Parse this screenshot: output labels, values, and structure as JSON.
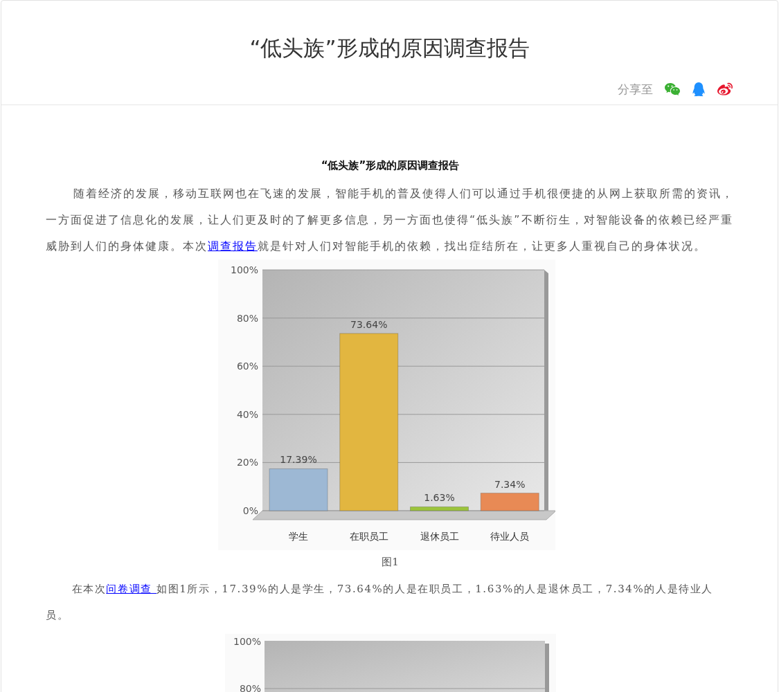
{
  "page_title": "“低头族”形成的原因调查报告",
  "share": {
    "label": "分享至",
    "targets": [
      {
        "kind": "wechat",
        "color": "#3cb034"
      },
      {
        "kind": "qq",
        "color": "#1e90ff"
      },
      {
        "kind": "weibo",
        "color": "#e6162d"
      }
    ]
  },
  "article": {
    "heading": "“低头族”形成的原因调查报告",
    "paragraph_1": {
      "before": "随着经济的发展，移动互联网也在飞速的发展，智能手机的普及使得人们可以通过手机很便捷的从网上获取所需的资讯，一方面促进了信息化的发展，让人们更及时的了解更多信息，另一方面也使得“低头族”不断衍生，对智能设备的依赖已经严重威胁到人们的身体健康。本次",
      "link": "调查报告",
      "after": "就是针对人们对智能手机的依赖，找出症结所在，让更多人重视自己的身体状况。"
    },
    "figure_1": {
      "caption": "图1",
      "chart_data": {
        "type": "bar",
        "categories": [
          "学生",
          "在职员工",
          "退休员工",
          "待业人员"
        ],
        "colors": [
          "#9db8d4",
          "#e2b640",
          "#9cc43c",
          "#e88a55"
        ],
        "grid": true,
        "series": [
          {
            "values": [
              17.4,
              73.6,
              1.6,
              7.3
            ]
          }
        ],
        "ylim": [
          0,
          100
        ],
        "yticks": [
          {
            "value": 0,
            "label": "0%"
          },
          {
            "value": 20,
            "label": "20%"
          },
          {
            "value": 40,
            "label": "40%"
          },
          {
            "value": 60,
            "label": "60%"
          },
          {
            "value": 80,
            "label": "80%"
          },
          {
            "value": 100,
            "label": "100%"
          }
        ],
        "value_labels": [
          "17.39%",
          "73.64%",
          "1.63%",
          "7.34%"
        ]
      }
    },
    "paragraph_2": {
      "before": "在本次",
      "link": "问卷调查 ",
      "after": "如图1所示，17.39%的人是学生，73.64%的人是在职员工，1.63%的人是退休员工，7.34%的人是待业人员。"
    },
    "figure_2": {
      "tick_labels": [
        "100%",
        "80%"
      ]
    }
  }
}
